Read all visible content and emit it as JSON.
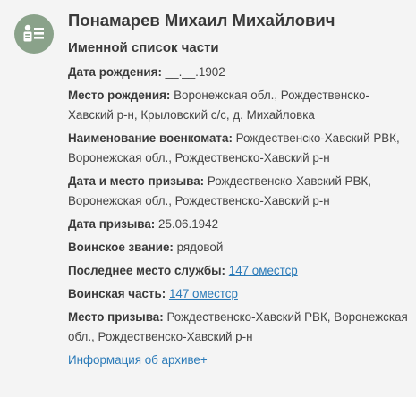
{
  "icon": "person-list-icon",
  "colors": {
    "avatar_bg": "#8aa28a",
    "link": "#2a7ab8"
  },
  "person": {
    "name": "Понамарев Михаил Михайлович",
    "list_type": "Именной список части"
  },
  "fields": {
    "birth_date": {
      "label": "Дата рождения:",
      "value": "__.__.1902"
    },
    "birth_place": {
      "label": "Место рождения:",
      "value": "Воронежская обл., Рождественско-Хавский р-н, Крыловский с/с, д. Михайловка"
    },
    "commissariat": {
      "label": "Наименование военкомата:",
      "value": "Рождественско-Хавский РВК, Воронежская обл., Рождественско-Хавский р-н"
    },
    "draft_date_place": {
      "label": "Дата и место призыва:",
      "value": "Рождественско-Хавский РВК, Воронежская обл., Рождественско-Хавский р-н"
    },
    "draft_date": {
      "label": "Дата призыва:",
      "value": "25.06.1942"
    },
    "rank": {
      "label": "Воинское звание:",
      "value": "рядовой"
    },
    "last_service": {
      "label": "Последнее место службы:",
      "value": "147 оместср"
    },
    "unit": {
      "label": "Воинская часть:",
      "value": "147 оместср"
    },
    "draft_place": {
      "label": "Место призыва:",
      "value": "Рождественско-Хавский РВК, Воронежская обл., Рождественско-Хавский р-н"
    }
  },
  "archive_link": "Информация об архиве+"
}
